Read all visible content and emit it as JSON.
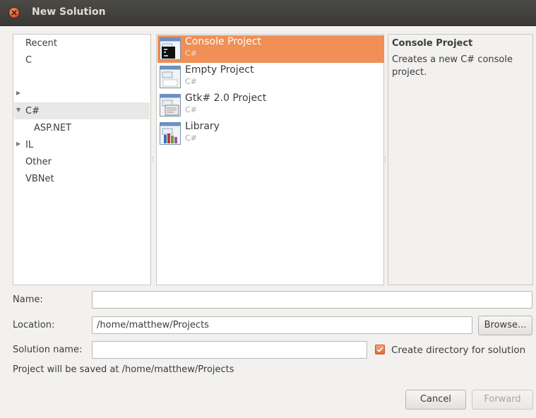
{
  "window": {
    "title": "New Solution"
  },
  "categories": [
    {
      "label": "Recent",
      "expander": ""
    },
    {
      "label": "C",
      "expander": "▶"
    },
    {
      "label": "C#",
      "expander": "▼",
      "selected": true
    },
    {
      "label": "ASP.NET",
      "expander": ""
    },
    {
      "label": "IL",
      "expander": ""
    },
    {
      "label": "Other",
      "expander": ""
    },
    {
      "label": "VBNet",
      "expander": "▶"
    }
  ],
  "templates": [
    {
      "name": "Console Project",
      "lang": "C#",
      "icon": "console-project-icon",
      "selected": true
    },
    {
      "name": "Empty Project",
      "lang": "C#",
      "icon": "empty-project-icon"
    },
    {
      "name": "Gtk# 2.0 Project",
      "lang": "C#",
      "icon": "gtk-project-icon"
    },
    {
      "name": "Library",
      "lang": "C#",
      "icon": "library-project-icon"
    }
  ],
  "description": {
    "title": "Console Project",
    "line1": "Creates a new C# console",
    "line2": "project."
  },
  "form": {
    "name_label": "Name:",
    "name_value": "",
    "location_label": "Location:",
    "location_value": "/home/matthew/Projects",
    "browse_label": "Browse...",
    "solution_label": "Solution name:",
    "solution_value": "",
    "create_dir_label": "Create directory for solution",
    "create_dir_checked": true,
    "saved_at": "Project will be saved at /home/matthew/Projects"
  },
  "buttons": {
    "cancel": "Cancel",
    "forward": "Forward"
  },
  "colors": {
    "selection": "#f08f56",
    "titlebar": "#3c3b37",
    "close": "#e0582a"
  }
}
